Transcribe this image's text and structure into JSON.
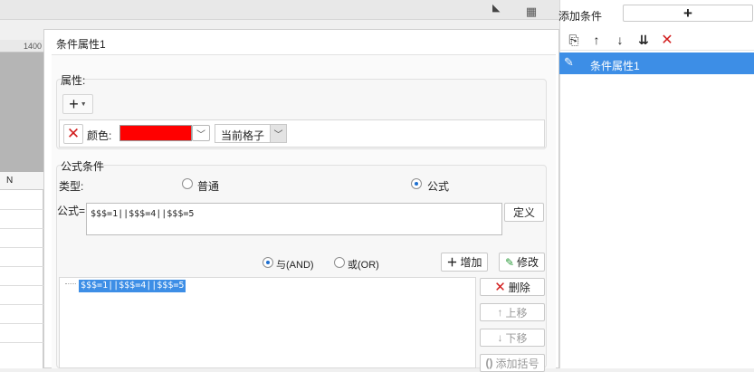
{
  "right_panel": {
    "add_condition_label": "添加条件",
    "add_condition_button": "+",
    "toolbar": {
      "copy": "⎘",
      "up": "↑",
      "down": "↓",
      "to_bottom": "⇊",
      "delete": "✕"
    },
    "conditions": [
      {
        "label": "条件属性1",
        "selected": true
      }
    ]
  },
  "sheet": {
    "ruler_value": "1400",
    "column_header": "N"
  },
  "dialog": {
    "title": "条件属性1",
    "attributes": {
      "section_label": "属性:",
      "add_button": "+",
      "color_label": "颜色:",
      "color_value": "#ff0000",
      "scope_value": "当前格子"
    },
    "formula_condition": {
      "section_label": "公式条件",
      "type_label": "类型:",
      "type_options": [
        {
          "label": "普通",
          "selected": false
        },
        {
          "label": "公式",
          "selected": true
        }
      ],
      "formula_label": "公式=",
      "formula_value": "$$$=1||$$$=4||$$$=5",
      "define_button": "定义",
      "logic_options": [
        {
          "label": "与(AND)",
          "selected": true
        },
        {
          "label": "或(OR)",
          "selected": false
        }
      ],
      "add_button": "增加",
      "edit_button": "修改",
      "conditions": [
        "$$$=1||$$$=4||$$$=5"
      ],
      "remove_button": "删除",
      "move_up_button": "上移",
      "move_down_button": "下移",
      "add_bracket_button": "添加括号"
    }
  }
}
